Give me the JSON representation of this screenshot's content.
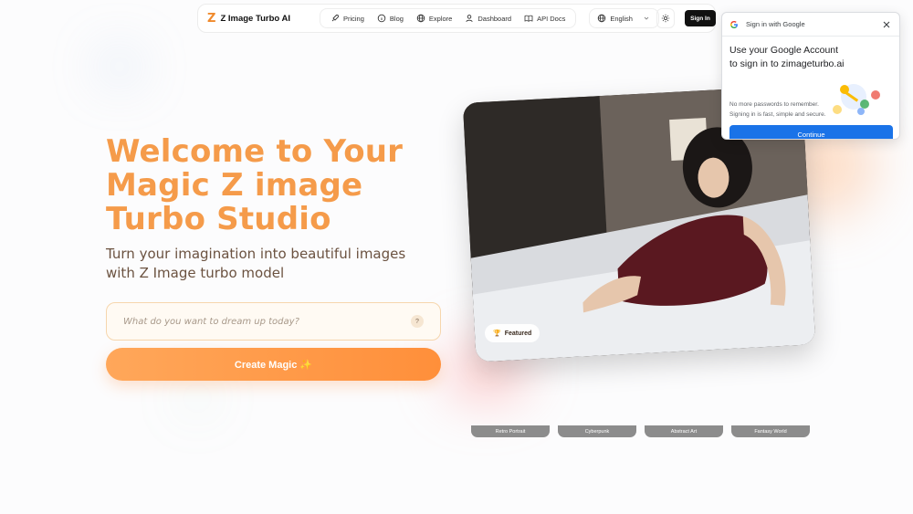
{
  "nav": {
    "brand_logo": "Z",
    "brand_name": "Z Image Turbo AI",
    "links": [
      {
        "label": "Pricing",
        "icon": "rocket-icon"
      },
      {
        "label": "Blog",
        "icon": "info-circle-icon"
      },
      {
        "label": "Explore",
        "icon": "globe-icon"
      },
      {
        "label": "Dashboard",
        "icon": "user-icon"
      },
      {
        "label": "API Docs",
        "icon": "book-icon"
      }
    ],
    "language": "English",
    "signin_label": "Sign In"
  },
  "hero": {
    "title": "Welcome to Your Magic Z image Turbo Studio",
    "subtitle": "Turn your imagination into beautiful images with Z Image turbo model",
    "prompt_placeholder": "What do you want to dream up today?",
    "help_label": "?",
    "create_label": "Create Magic ✨"
  },
  "featured": {
    "badge_icon": "🏆",
    "badge_label": "Featured"
  },
  "styles": [
    "Retro Portrait",
    "Cyberpunk",
    "Abstract Art",
    "Fantasy World"
  ],
  "google_popup": {
    "header": "Sign in with Google",
    "title": "Use your Google Account to sign in to zimageturbo.ai",
    "description": "No more passwords to remember. Signing in is fast, simple and secure.",
    "continue_label": "Continue"
  },
  "colors": {
    "accent": "#f59b4a",
    "button_gradient_start": "#ffa75a",
    "button_gradient_end": "#ff8f3a",
    "google_blue": "#1a73e8"
  }
}
